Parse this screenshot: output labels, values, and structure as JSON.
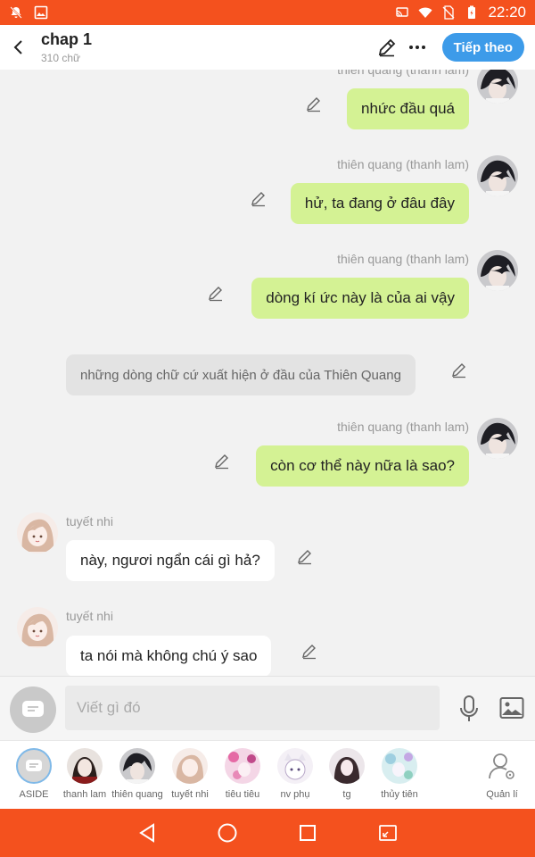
{
  "status_bar": {
    "time": "22:20",
    "icons": [
      "notifications-off-icon",
      "image-icon",
      "cast-icon",
      "wifi-icon",
      "no-sim-icon",
      "battery-icon"
    ],
    "color": "#f4511e"
  },
  "header": {
    "title": "chap 1",
    "subtitle": "310 chữ",
    "next_label": "Tiếp theo",
    "icons": [
      "back-icon",
      "pencil-icon",
      "more-icon"
    ],
    "accent": "#3d9be9"
  },
  "messages": [
    {
      "type": "right",
      "name": "thiên quang (thanh lam)",
      "text": "nhức đầu quá"
    },
    {
      "type": "right",
      "name": "thiên quang (thanh lam)",
      "text": "hử, ta đang ở đâu đây"
    },
    {
      "type": "right",
      "name": "thiên quang (thanh lam)",
      "text": "dòng kí ức này là của ai vậy"
    },
    {
      "type": "narration",
      "text": "những dòng chữ cứ xuất hiện ở đầu của Thiên Quang"
    },
    {
      "type": "right",
      "name": "thiên quang (thanh lam)",
      "text": "còn cơ thể này nữa là sao?"
    },
    {
      "type": "left",
      "name": "tuyết nhi",
      "text": "này, ngươi ngẩn cái gì hả?"
    },
    {
      "type": "left",
      "name": "tuyết nhi",
      "text": "ta nói mà không chú ý sao"
    }
  ],
  "input": {
    "placeholder": "Viết gì đó",
    "icons": [
      "chat-mode-icon",
      "microphone-icon",
      "image-icon"
    ]
  },
  "characters": [
    {
      "label": "ASIDE",
      "icon": "aside-icon"
    },
    {
      "label": "thanh lam",
      "icon": "avatar"
    },
    {
      "label": "thiên quang",
      "icon": "avatar"
    },
    {
      "label": "tuyết nhi",
      "icon": "avatar"
    },
    {
      "label": "tiêu tiêu",
      "icon": "avatar"
    },
    {
      "label": "nv phụ",
      "icon": "avatar"
    },
    {
      "label": "tg",
      "icon": "avatar"
    },
    {
      "label": "thủy tiên",
      "icon": "avatar"
    },
    {
      "label": "Quản lí",
      "icon": "manage-user-icon"
    }
  ],
  "nav": {
    "icons": [
      "back-triangle-icon",
      "home-circle-icon",
      "recents-square-icon",
      "screen-icon"
    ]
  },
  "colors": {
    "bubble_right": "#d4f294",
    "bubble_left": "#ffffff",
    "narration": "#e3e3e3",
    "chat_bg": "#f2f2f2"
  }
}
